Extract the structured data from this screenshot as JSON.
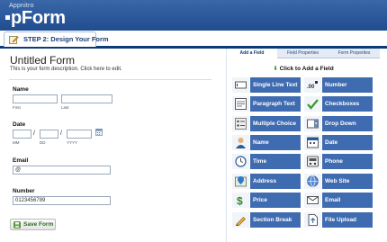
{
  "header": {
    "brand_small": "Appnitro",
    "brand_main": "pForm"
  },
  "step": {
    "label": "STEP 2: Design Your Form"
  },
  "form": {
    "title": "Untitled Form",
    "description": "This is your form description. Click here to edit.",
    "fields": {
      "name": {
        "label": "Name",
        "first_sub": "First",
        "last_sub": "Last"
      },
      "date": {
        "label": "Date",
        "mm_sub": "MM",
        "dd_sub": "DD",
        "yyyy_sub": "YYYY",
        "separator": "/"
      },
      "email": {
        "label": "Email",
        "value": "@"
      },
      "number": {
        "label": "Number",
        "value": "0123456789"
      }
    },
    "save_label": "Save Form"
  },
  "panel": {
    "tabs": [
      "Add a Field",
      "Field Properties",
      "Form Properties"
    ],
    "active_tab": "Add a Field",
    "hint": "Click to Add a Field",
    "field_types": [
      {
        "label": "Single Line Text",
        "icon": "text-field-icon"
      },
      {
        "label": "Number",
        "icon": "number-icon"
      },
      {
        "label": "Paragraph Text",
        "icon": "paragraph-icon"
      },
      {
        "label": "Checkboxes",
        "icon": "checkmark-icon"
      },
      {
        "label": "Multiple Choice",
        "icon": "radio-list-icon"
      },
      {
        "label": "Drop Down",
        "icon": "dropdown-icon"
      },
      {
        "label": "Name",
        "icon": "person-icon"
      },
      {
        "label": "Date",
        "icon": "calendar-icon"
      },
      {
        "label": "Time",
        "icon": "clock-icon"
      },
      {
        "label": "Phone",
        "icon": "phone-icon"
      },
      {
        "label": "Address",
        "icon": "map-pin-icon"
      },
      {
        "label": "Web Site",
        "icon": "globe-icon"
      },
      {
        "label": "Price",
        "icon": "dollar-icon"
      },
      {
        "label": "Email",
        "icon": "envelope-icon"
      },
      {
        "label": "Section Break",
        "icon": "pencil-icon"
      },
      {
        "label": "File Upload",
        "icon": "file-upload-icon"
      }
    ]
  },
  "colors": {
    "header_blue": "#2a5a9c",
    "button_blue": "#3f6bb1",
    "accent_green": "#3a9a2a"
  }
}
